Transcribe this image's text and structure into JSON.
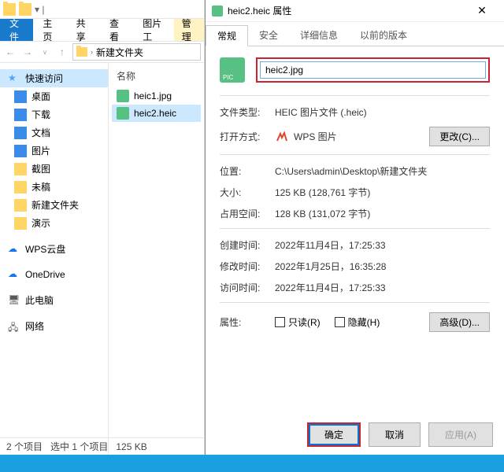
{
  "explorer": {
    "ribbon": {
      "file": "文件",
      "home": "主页",
      "share": "共享",
      "view": "查看",
      "picTools": "图片工",
      "manage": "管理"
    },
    "breadcrumb": {
      "folder": "新建文件夹"
    },
    "sidebar": {
      "quick": "快速访问",
      "desktop": "桌面",
      "downloads": "下载",
      "documents": "文档",
      "pictures": "图片",
      "screenshots": "截图",
      "unfinished": "未稿",
      "newfolder": "新建文件夹",
      "demo": "演示",
      "wps": "WPS云盘",
      "onedrive": "OneDrive",
      "thispc": "此电脑",
      "network": "网络"
    },
    "filelist": {
      "header": "名称",
      "items": [
        {
          "name": "heic1.jpg",
          "selected": false
        },
        {
          "name": "heic2.heic",
          "selected": true
        }
      ]
    },
    "statusbar": {
      "count": "2 个项目",
      "selection": "选中 1 个项目",
      "size": "125 KB"
    }
  },
  "props": {
    "title": "heic2.heic 属性",
    "tabs": {
      "general": "常规",
      "security": "安全",
      "details": "详细信息",
      "previous": "以前的版本"
    },
    "filename": "heic2.jpg",
    "fields": {
      "filetype_lbl": "文件类型:",
      "filetype_val": "HEIC 图片文件 (.heic)",
      "openwith_lbl": "打开方式:",
      "openwith_val": "WPS 图片",
      "change_btn": "更改(C)...",
      "location_lbl": "位置:",
      "location_val": "C:\\Users\\admin\\Desktop\\新建文件夹",
      "size_lbl": "大小:",
      "size_val": "125 KB (128,761 字节)",
      "sizedisk_lbl": "占用空间:",
      "sizedisk_val": "128 KB (131,072 字节)",
      "created_lbl": "创建时间:",
      "created_val": "2022年11月4日，17:25:33",
      "modified_lbl": "修改时间:",
      "modified_val": "2022年1月25日，16:35:28",
      "accessed_lbl": "访问时间:",
      "accessed_val": "2022年11月4日，17:25:33",
      "attrs_lbl": "属性:",
      "readonly": "只读(R)",
      "hidden": "隐藏(H)",
      "advanced": "高级(D)..."
    },
    "buttons": {
      "ok": "确定",
      "cancel": "取消",
      "apply": "应用(A)"
    }
  }
}
